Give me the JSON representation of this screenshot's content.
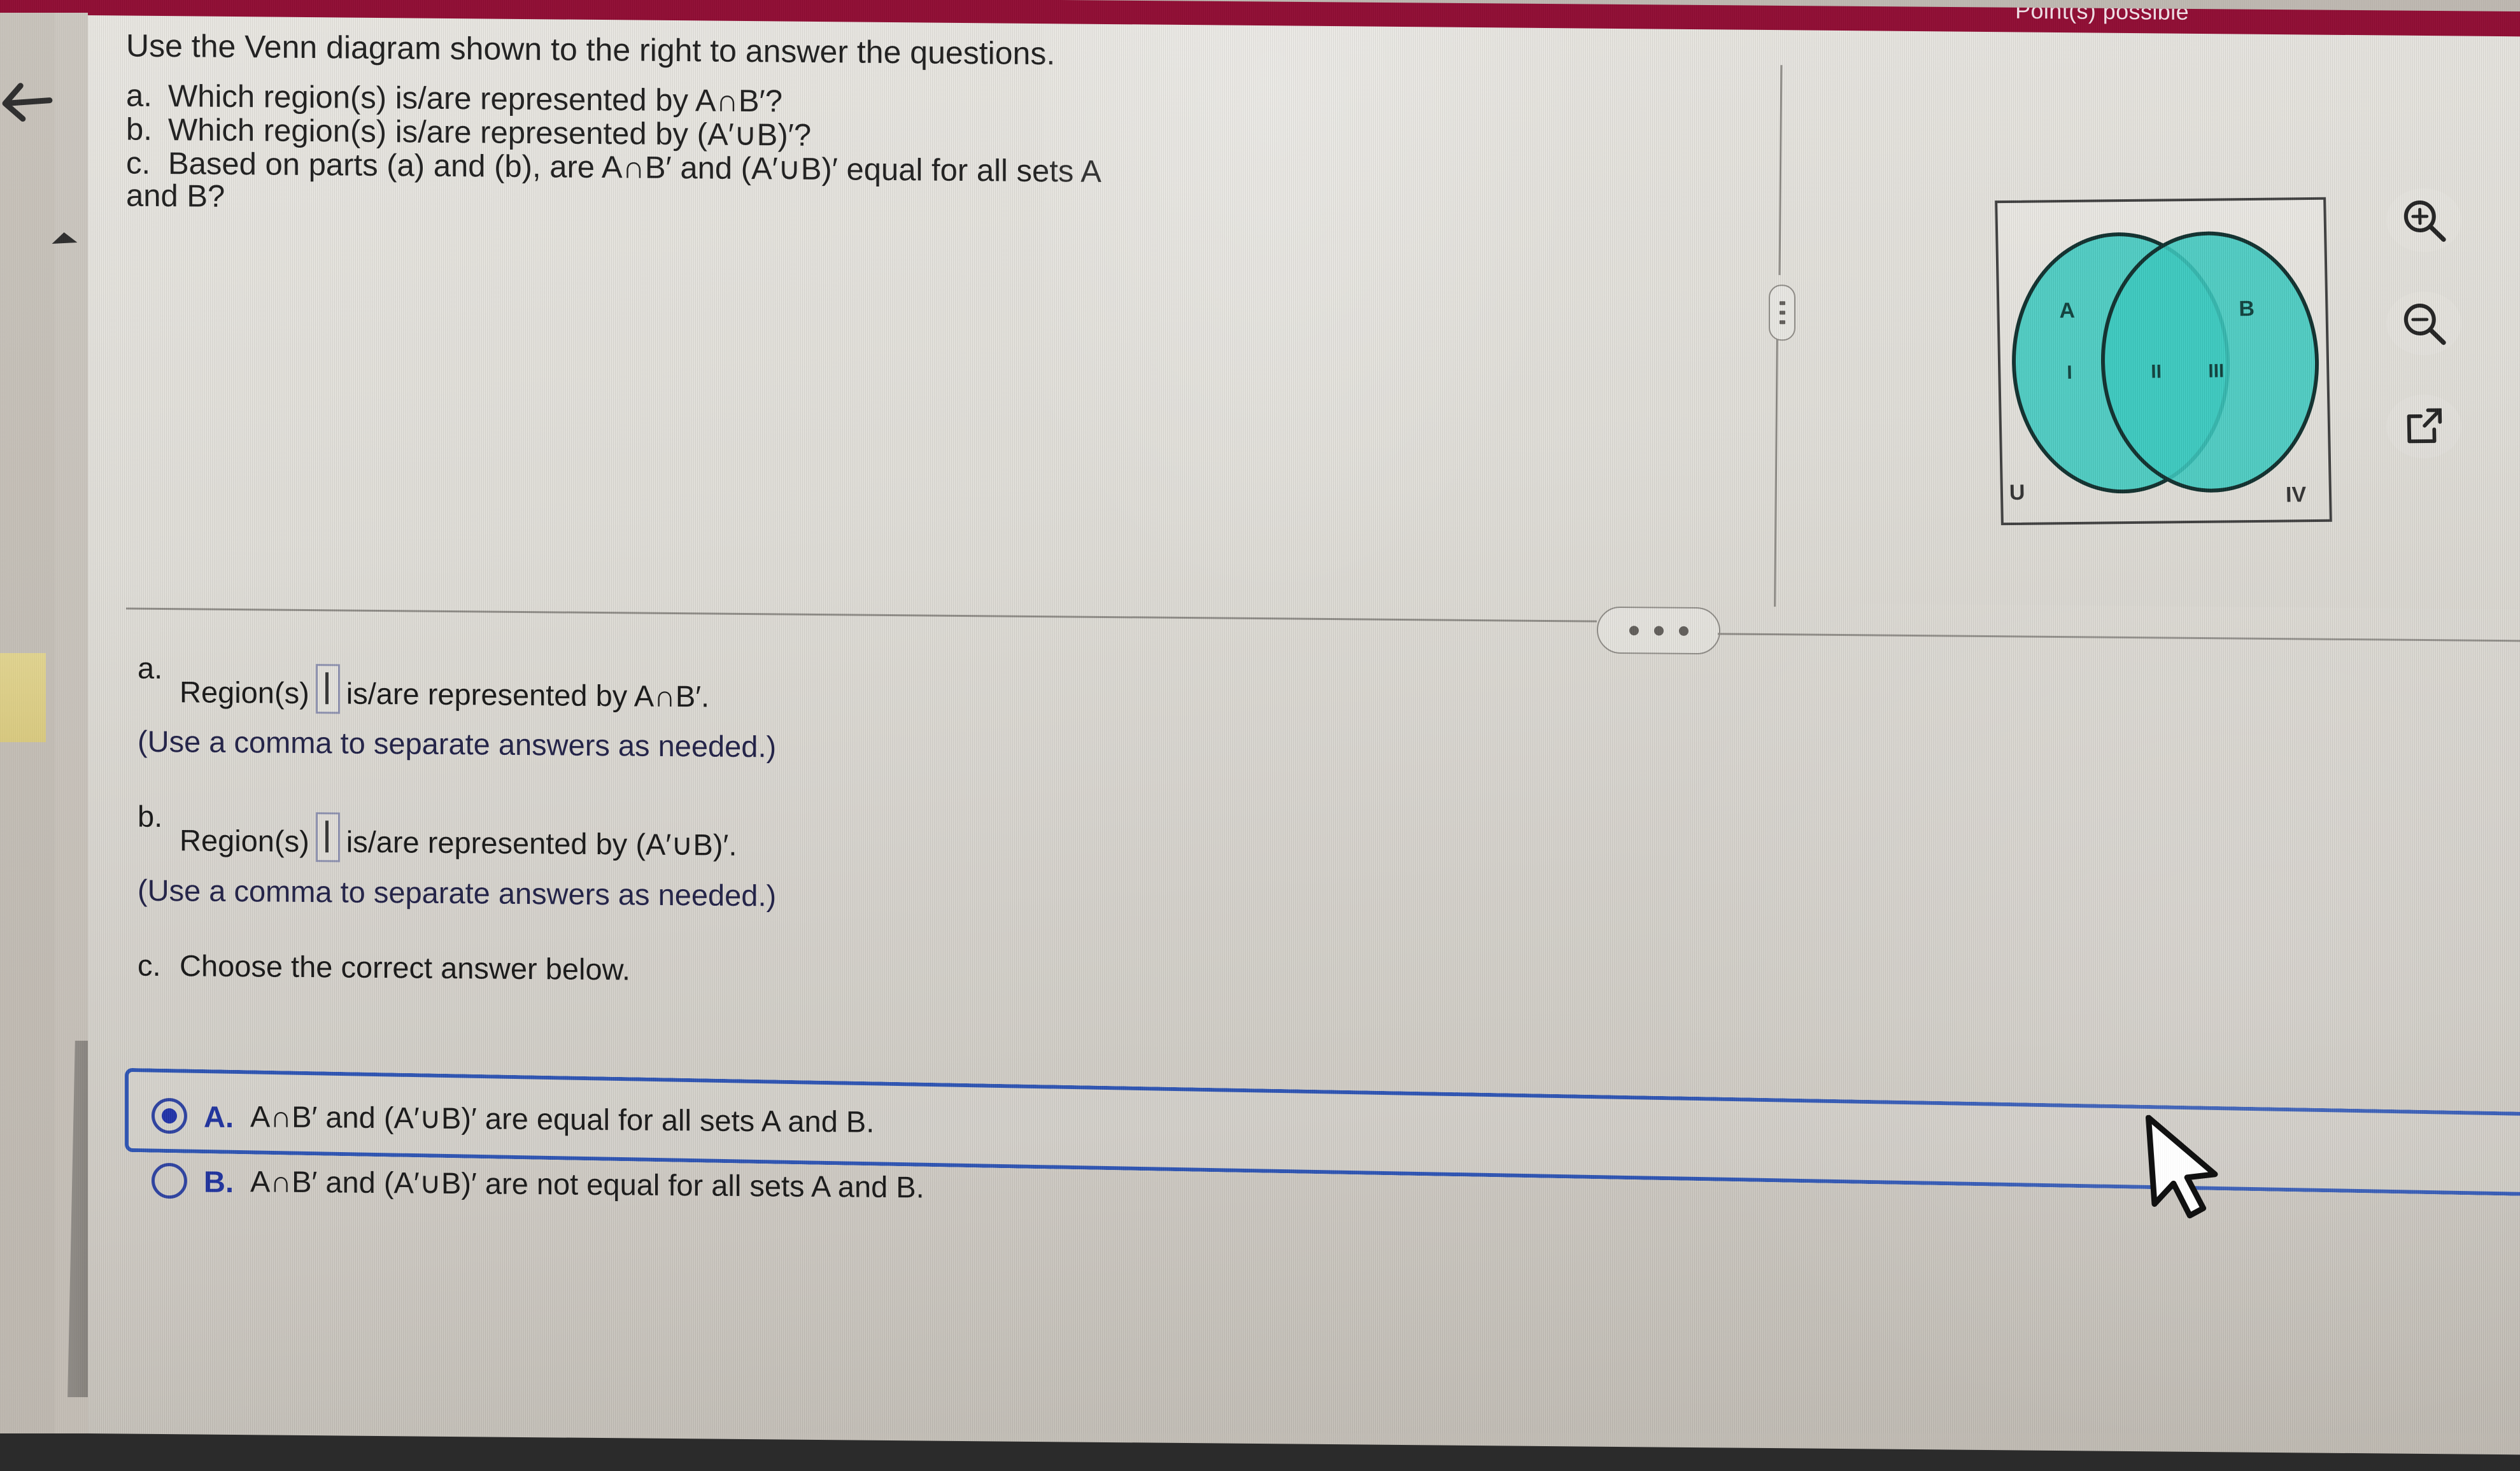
{
  "banner": {
    "points_text": "Point(s) possible"
  },
  "nav": {
    "back_icon": "back-arrow-icon",
    "collapse_icon": "caret-up-icon"
  },
  "question": {
    "prompt": "Use the Venn diagram shown to the right to answer the questions.",
    "parts": [
      {
        "label": "a.",
        "text": "Which region(s) is/are represented by A∩B′?"
      },
      {
        "label": "b.",
        "text": "Which region(s) is/are represented by (A′∪B)′?"
      },
      {
        "label": "c.",
        "text": "Based on parts (a) and (b), are A∩B′ and (A′∪B)′ equal for all sets A"
      }
    ],
    "continuation": "and B?"
  },
  "venn": {
    "set_a_label": "A",
    "set_b_label": "B",
    "region_1": "I",
    "region_2": "II",
    "region_3": "III",
    "region_4": "IV",
    "universe_label": "U",
    "fill_color": "#38c8be",
    "overlap_color": "#12968e",
    "outline_color": "#0d2d2b"
  },
  "toolbar": {
    "zoom_in": "zoom-in-icon",
    "zoom_out": "zoom-out-icon",
    "open_new_window": "open-in-new-window-icon"
  },
  "answers": {
    "a": {
      "label": "a.",
      "prefix": "Region(s)",
      "suffix": "is/are represented by A∩B′.",
      "input_value": "",
      "hint": "(Use a comma to separate answers as needed.)"
    },
    "b": {
      "label": "b.",
      "prefix": "Region(s)",
      "suffix": "is/are represented by (A′∪B)′.",
      "input_value": "",
      "hint": "(Use a comma to separate answers as needed.)"
    },
    "c": {
      "label": "c.",
      "prompt": "Choose the correct answer below.",
      "options": [
        {
          "key": "A.",
          "text": "A∩B′ and (A′∪B)′ are equal for all sets A and B.",
          "selected": true
        },
        {
          "key": "B.",
          "text": "A∩B′ and (A′∪B)′ are not equal for all sets A and B.",
          "selected": false
        }
      ]
    }
  },
  "colors": {
    "banner_red": "#8f0c33",
    "selection_blue": "#2a52b3",
    "radio_blue": "#1d2fa8",
    "hint_text": "#1d1d44"
  }
}
